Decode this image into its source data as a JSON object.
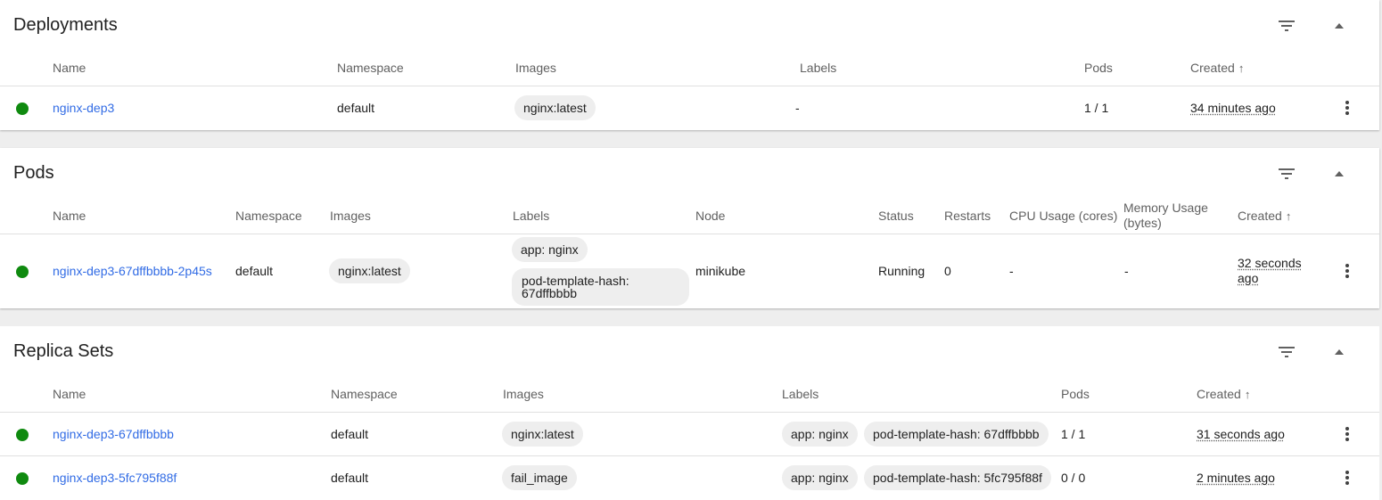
{
  "icons": {
    "filter": "filter-icon",
    "collapse": "chevron-up-icon",
    "more": "more-vert-icon",
    "sort": "arrow-up-icon",
    "status": "status-dot-icon"
  },
  "colors": {
    "link": "#326ce5",
    "status_ok": "#0f8a0f",
    "chip_bg": "#eeeeee"
  },
  "deployments": {
    "title": "Deployments",
    "columns": {
      "name": "Name",
      "namespace": "Namespace",
      "images": "Images",
      "labels": "Labels",
      "pods": "Pods",
      "created": "Created",
      "sort_arrow": "↑"
    },
    "rows": [
      {
        "name": "nginx-dep3",
        "namespace": "default",
        "image": "nginx:latest",
        "labels": "-",
        "pods": "1 / 1",
        "created": "34 minutes ago"
      }
    ]
  },
  "pods": {
    "title": "Pods",
    "columns": {
      "name": "Name",
      "namespace": "Namespace",
      "images": "Images",
      "labels": "Labels",
      "node": "Node",
      "status": "Status",
      "restarts": "Restarts",
      "cpu": "CPU Usage (cores)",
      "memory": "Memory Usage (bytes)",
      "created": "Created",
      "sort_arrow": "↑"
    },
    "rows": [
      {
        "name": "nginx-dep3-67dffbbbb-2p45s",
        "namespace": "default",
        "image": "nginx:latest",
        "label1": "app: nginx",
        "label2": "pod-template-hash: 67dffbbbb",
        "node": "minikube",
        "status": "Running",
        "restarts": "0",
        "cpu": "-",
        "memory": "-",
        "created": "32 seconds ago"
      }
    ]
  },
  "replicasets": {
    "title": "Replica Sets",
    "columns": {
      "name": "Name",
      "namespace": "Namespace",
      "images": "Images",
      "labels": "Labels",
      "pods": "Pods",
      "created": "Created",
      "sort_arrow": "↑"
    },
    "rows": [
      {
        "name": "nginx-dep3-67dffbbbb",
        "namespace": "default",
        "image": "nginx:latest",
        "label1": "app: nginx",
        "label2": "pod-template-hash: 67dffbbbb",
        "pods": "1 / 1",
        "created": "31 seconds ago"
      },
      {
        "name": "nginx-dep3-5fc795f88f",
        "namespace": "default",
        "image": "fail_image",
        "label1": "app: nginx",
        "label2": "pod-template-hash: 5fc795f88f",
        "pods": "0 / 0",
        "created": "2 minutes ago"
      }
    ]
  }
}
